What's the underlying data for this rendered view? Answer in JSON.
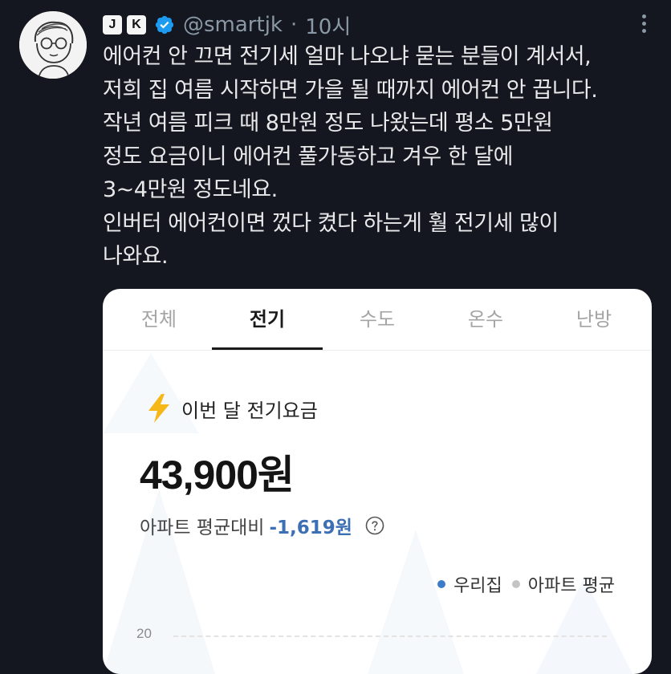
{
  "author": {
    "badge_letters": [
      "J",
      "K"
    ],
    "handle": "@smartjk",
    "separator": "·",
    "time": "10시",
    "verified_color": "#1d9bf0"
  },
  "tweet": {
    "lines": [
      "에어컨 안 끄면 전기세 얼마 나오냐 묻는 분들이 계서서,",
      "저희 집 여름 시작하면 가을 될 때까지 에어컨 안 끕니다.",
      "작년 여름 피크 때 8만원 정도 나왔는데 평소 5만원",
      "정도 요금이니 에어컨 풀가동하고 겨우 한 달에",
      "3~4만원 정도네요.",
      "인버터 에어컨이면 껐다 켰다 하는게 훨 전기세 많이",
      "나와요."
    ]
  },
  "card": {
    "tabs": [
      "전체",
      "전기",
      "수도",
      "온수",
      "난방"
    ],
    "active_tab": "전기",
    "bill_label": "이번 달 전기요금",
    "amount": "43,900원",
    "compare_label": "아파트 평균대비",
    "compare_value": "-1,619원",
    "legend": [
      {
        "label": "우리집",
        "color": "#3d7cc9"
      },
      {
        "label": "아파트 평균",
        "color": "#c4c4c4"
      }
    ],
    "y_tick": "20",
    "accent": "#3d6fb5",
    "bolt_color": "#f5b818"
  }
}
